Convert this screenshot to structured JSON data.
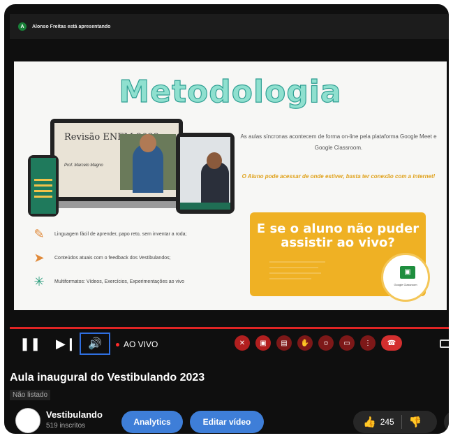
{
  "meet": {
    "presenter_initial": "A",
    "presenter_text": "Alonso Freitas está apresentando"
  },
  "slide": {
    "title": "Metodologia",
    "laptop_title": "Revisão ENEM 2022",
    "laptop_prof": "Prof. Marcelo Magno",
    "text_1": "As aulas síncronas acontecem de forma on-line pela plataforma Google Meet e Google Classroom.",
    "text_2": "O Aluno pode acessar de onde estiver, basta ter conexão com a internet!",
    "features": [
      {
        "icon": "pencil-icon",
        "glyph": "✎",
        "text": "Linguagem fácil de aprender, papo reto, sem inventar a roda;"
      },
      {
        "icon": "send-icon",
        "glyph": "➤",
        "text": "Conteúdos atuais com o feedback dos Vestibulandos;"
      },
      {
        "icon": "network-icon",
        "glyph": "✳",
        "text": "Multiformatos: Vídeos, Exercícios, Experimentações ao vivo"
      }
    ],
    "callout_title": "E se o aluno não puder assistir ao vivo?",
    "gc_label": "Google Classroom"
  },
  "player": {
    "live_label": "AO VIVO"
  },
  "video": {
    "title": "Aula inaugural do Vestibulando 2023",
    "visibility": "Não listado"
  },
  "channel": {
    "name": "Vestibulando",
    "subscribers": "519 inscritos",
    "analytics_label": "Analytics",
    "edit_label": "Editar vídeo",
    "likes": "245"
  },
  "colors": {
    "accent_red": "#e02424",
    "button_blue": "#3e7ed8",
    "callout_yellow": "#efb124",
    "title_teal": "#8fe0cf"
  }
}
